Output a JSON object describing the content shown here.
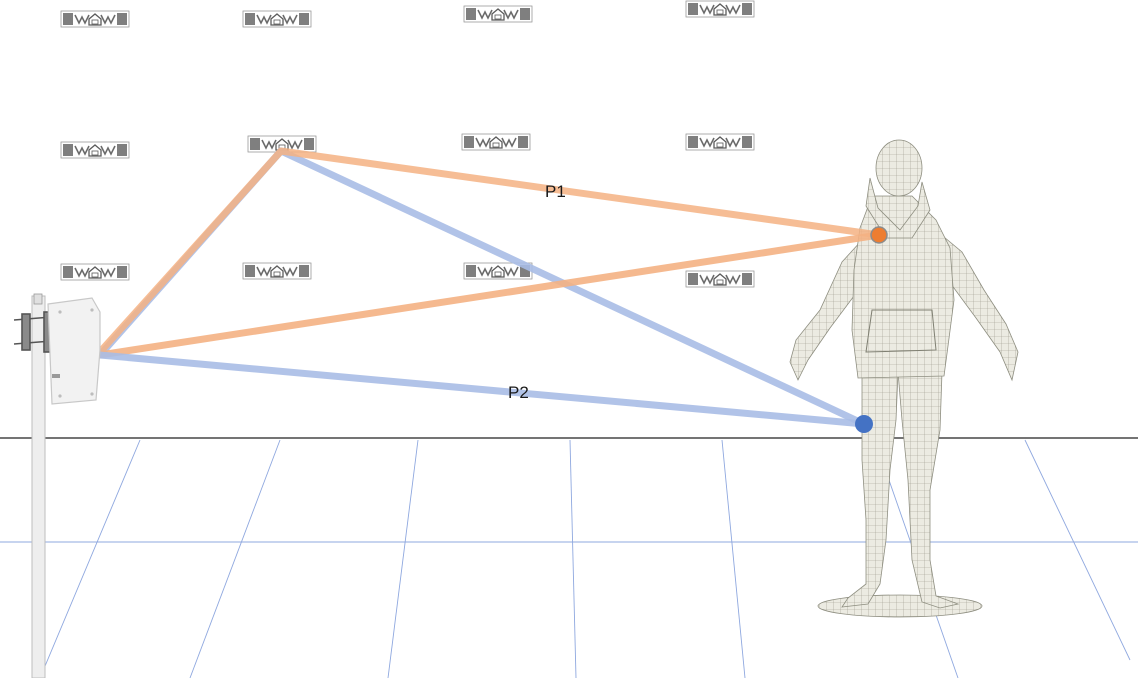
{
  "diagram": {
    "paths": [
      {
        "id": "p1",
        "label": "P1",
        "color": "#f4b183",
        "endpoint_color": "#ed7d31"
      },
      {
        "id": "p2",
        "label": "P2",
        "color": "#a9bde6",
        "endpoint_color": "#4472c4"
      }
    ],
    "colors": {
      "floor_grid": "#8fa8df",
      "horizon": "#222222",
      "tag": "#7f7f7f",
      "pole": "#eeeeee",
      "antenna": "#f2f2f2",
      "mannequin": "#ecebe2",
      "mesh_line": "#9a9a8c"
    },
    "icons": [
      "rfid-tag-icon",
      "reader-antenna-icon",
      "mannequin-figure"
    ]
  }
}
